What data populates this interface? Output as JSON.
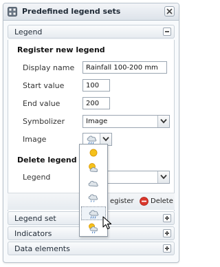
{
  "window": {
    "title": "Predefined legend sets"
  },
  "legend_section": {
    "header": "Legend",
    "register": {
      "heading": "Register new legend",
      "display_name_label": "Display name",
      "display_name_value": "Rainfall 100-200 mm",
      "start_value_label": "Start value",
      "start_value_value": "100",
      "end_value_label": "End value",
      "end_value_value": "200",
      "symbolizer_label": "Symbolizer",
      "symbolizer_value": "Image",
      "image_label": "Image"
    },
    "delete": {
      "heading": "Delete legend",
      "legend_label": "Legend"
    },
    "footer": {
      "register_label": "egister",
      "delete_label": "Delete"
    }
  },
  "collapsed_sections": [
    {
      "label": "Legend set"
    },
    {
      "label": "Indicators"
    },
    {
      "label": "Data elements"
    }
  ],
  "image_dropdown": {
    "options": [
      {
        "icon": "sun-icon"
      },
      {
        "icon": "sun-cloud-icon"
      },
      {
        "icon": "cloud-icon"
      },
      {
        "icon": "cloud-light-rain-icon"
      },
      {
        "icon": "cloud-rain-icon",
        "hovered": true
      },
      {
        "icon": "sun-cloud-rain-icon"
      }
    ]
  },
  "colors": {
    "border": "#b9c3cd",
    "header_gradient_top": "#f3f5f8",
    "header_gradient_bottom": "#dde3ea",
    "delete_red": "#d9362b",
    "sun_yellow": "#f5c11a"
  }
}
